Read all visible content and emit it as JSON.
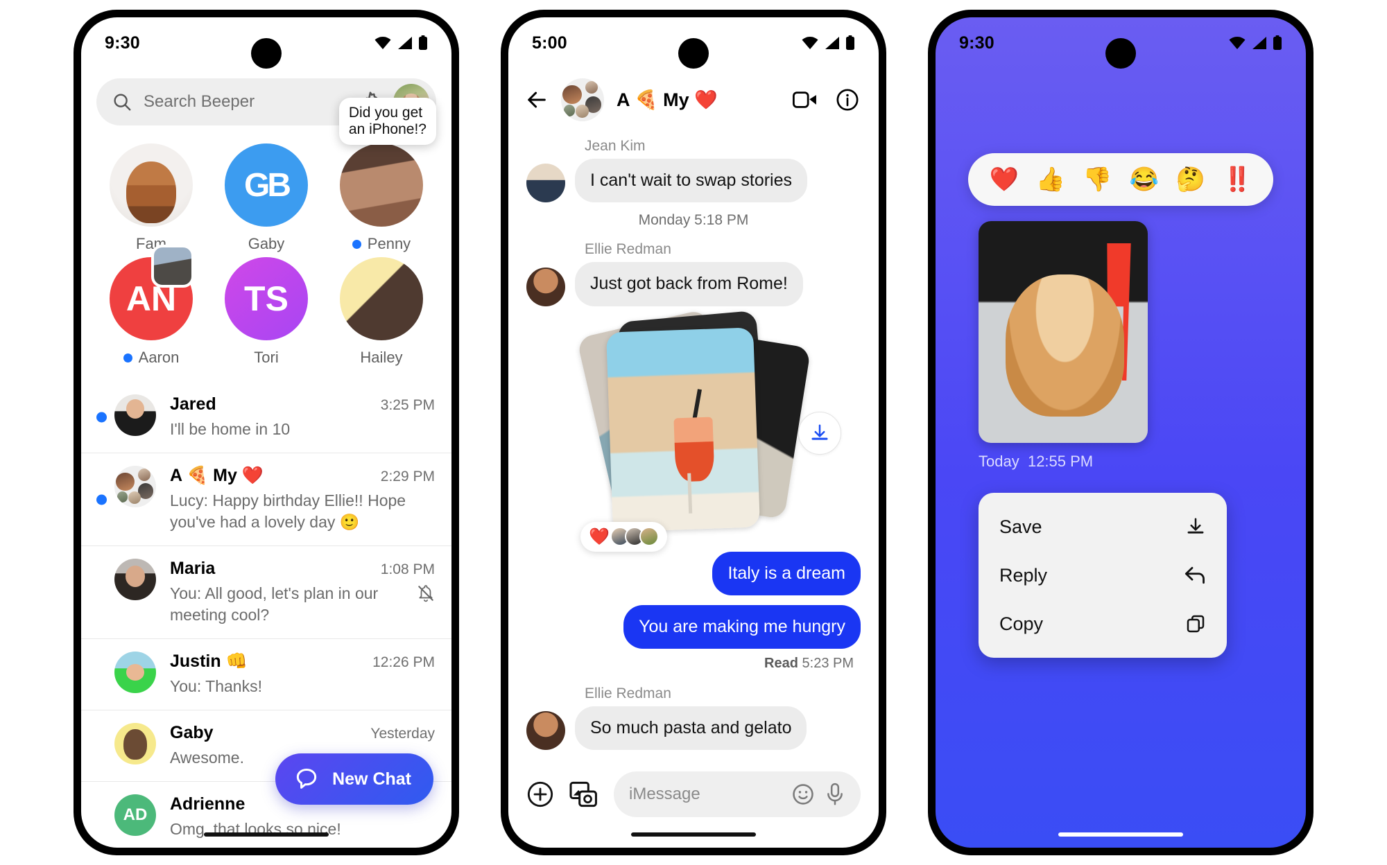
{
  "phones": [
    {
      "id": "chat-list",
      "status": {
        "time": "9:30",
        "icons": [
          "wifi-icon",
          "cellular-icon",
          "battery-icon"
        ]
      },
      "search": {
        "placeholder": "Search Beeper",
        "icon": "search-icon",
        "settings_icon": "gear-icon",
        "avatar": "profile-avatar"
      },
      "pinned": [
        {
          "name": "Fam",
          "unread": false,
          "art": "av-fam",
          "initials": ""
        },
        {
          "name": "Gaby",
          "unread": false,
          "art": "av-gaby",
          "initials": "GB"
        },
        {
          "name": "Penny",
          "unread": true,
          "art": "av-penny",
          "initials": "",
          "bubble": "Did you get\nan iPhone!?"
        },
        {
          "name": "Aaron",
          "unread": true,
          "art": "av-aaron",
          "initials": "AN",
          "badge": true
        },
        {
          "name": "Tori",
          "unread": false,
          "art": "av-tori",
          "initials": "TS"
        },
        {
          "name": "Hailey",
          "unread": false,
          "art": "av-hailey",
          "initials": ""
        }
      ],
      "conversations": [
        {
          "name": "Jared",
          "time": "3:25 PM",
          "preview": "I'll be home in 10",
          "unread": true,
          "art": "av-jared",
          "muted": false,
          "initials": ""
        },
        {
          "name": "A 🍕 My ❤️",
          "time": "2:29 PM",
          "preview": "Lucy: Happy birthday Ellie!! Hope you've had a lovely day  🙂",
          "unread": true,
          "art": "av-group",
          "muted": false,
          "initials": ""
        },
        {
          "name": "Maria",
          "time": "1:08 PM",
          "preview": "You: All good, let's plan in our meeting cool?",
          "unread": false,
          "art": "av-maria",
          "muted": true,
          "initials": ""
        },
        {
          "name": "Justin 👊",
          "time": "12:26 PM",
          "preview": "You: Thanks!",
          "unread": false,
          "art": "av-justin",
          "muted": false,
          "initials": ""
        },
        {
          "name": "Gaby",
          "time": "Yesterday",
          "preview": "Awesome.",
          "unread": false,
          "art": "av-gabyrow",
          "muted": false,
          "initials": ""
        },
        {
          "name": "Adrienne",
          "time": "",
          "preview": "Omg, that looks so nice!",
          "unread": false,
          "art": "av-ad",
          "muted": false,
          "initials": "AD"
        }
      ],
      "fab": {
        "label": "New Chat",
        "icon": "chat-bubble-icon"
      }
    },
    {
      "id": "conversation",
      "status": {
        "time": "5:00"
      },
      "header": {
        "back_icon": "back-arrow-icon",
        "title": "A 🍕 My ❤️",
        "video_icon": "video-camera-icon",
        "info_icon": "info-icon"
      },
      "messages": [
        {
          "kind": "in",
          "sender": "Jean Kim",
          "text": "I can't wait to swap stories",
          "avatar": "jean-avatar"
        },
        {
          "kind": "daystamp",
          "text": "Monday 5:18 PM"
        },
        {
          "kind": "in",
          "sender": "Ellie Redman",
          "text": "Just got back from Rome!",
          "avatar": "ellie-avatar"
        },
        {
          "kind": "photos",
          "reaction": "❤️",
          "reactors": 3,
          "download_icon": "download-icon"
        },
        {
          "kind": "out",
          "text": "Italy is a dream"
        },
        {
          "kind": "out",
          "text": "You are making me hungry"
        },
        {
          "kind": "read",
          "label": "Read",
          "time": "5:23 PM"
        },
        {
          "kind": "in",
          "sender": "Ellie Redman",
          "text": "So much pasta and gelato",
          "avatar": "ellie-avatar"
        }
      ],
      "composer": {
        "plus_icon": "plus-circle-icon",
        "media_icon": "photo-camera-icon",
        "placeholder": "iMessage",
        "emoji_icon": "emoji-smiley-icon",
        "mic_icon": "microphone-icon"
      }
    },
    {
      "id": "reactions",
      "status": {
        "time": "9:30"
      },
      "reactions": [
        "❤️",
        "👍",
        "👎",
        "😂",
        "🤔",
        "‼️"
      ],
      "photo": {
        "alt": "dog-photo"
      },
      "timestamp": {
        "day": "Today",
        "time": "12:55 PM"
      },
      "menu": [
        {
          "label": "Save",
          "icon": "download-icon"
        },
        {
          "label": "Reply",
          "icon": "reply-arrow-icon"
        },
        {
          "label": "Copy",
          "icon": "copy-icon"
        }
      ]
    }
  ],
  "colors": {
    "accent_blue": "#1a36f3",
    "unread_dot": "#1a73ff",
    "purple_bg": "#5a4df4",
    "fab_gradient_start": "#5b46f0",
    "fab_gradient_end": "#2f5bf0"
  }
}
